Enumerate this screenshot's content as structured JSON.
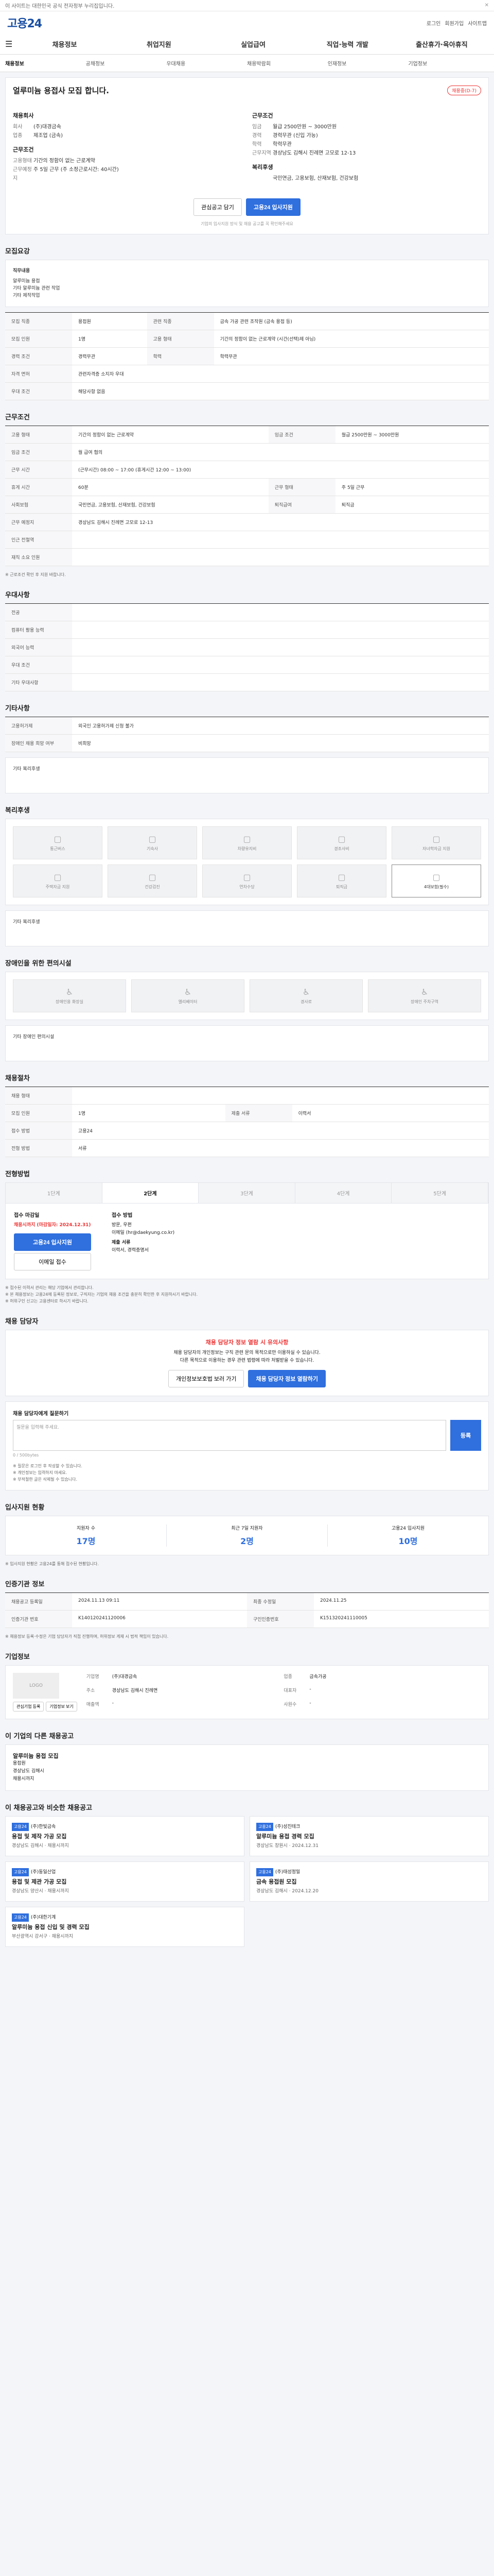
{
  "topbar": {
    "text": "이 사이트는 대한민국 공식 전자정부 누리집입니다.",
    "close": "✕"
  },
  "header": {
    "logo": "고용24",
    "links": [
      "로그인",
      "회원가입",
      "사이트맵"
    ]
  },
  "nav": {
    "items": [
      "채용정보",
      "취업지원",
      "실업급여",
      "직업·능력 개발",
      "출산휴가·육아휴직"
    ]
  },
  "subnav": {
    "items": [
      "채용정보",
      "공채정보",
      "우대채용",
      "채용박람회",
      "인재정보",
      "기업정보"
    ]
  },
  "job": {
    "title": "얼루미늄 용접사 모집 합니다.",
    "badge": "채용중(D-7)",
    "left_h1": "채용회사",
    "left_rows": [
      {
        "k": "회사",
        "v": "(주)대경금속"
      },
      {
        "k": "업종",
        "v": "제조업 (금속)"
      }
    ],
    "left_h2": "근무조건",
    "left_rows2": [
      {
        "k": "고용형태",
        "v": "기간의 정함이 없는 근로계약"
      },
      {
        "k": "근무예정지",
        "v": "주 5일 근무 (주 소정근로시간: 40시간)"
      }
    ],
    "right_h1": "근무조건",
    "right_rows": [
      {
        "k": "임금",
        "v": "월급 2500만원 ~ 3000만원"
      },
      {
        "k": "경력",
        "v": "경력무관 (신입 가능)"
      },
      {
        "k": "학력",
        "v": "학력무관"
      },
      {
        "k": "근무지역",
        "v": "경상남도 김해시 진례면 고모로 12-13"
      }
    ],
    "right_h2": "복리후생",
    "right_rows2": [
      {
        "k": "",
        "v": "국민연금, 고용보험, 산재보험, 건강보험"
      }
    ],
    "btn_interest": "관심공고 담기",
    "btn_apply": "고용24 입사지원",
    "note": "기업의 입사지원 방식 및 채용 공고를 꼭 확인해주세요"
  },
  "sec_detail": {
    "title": "모집요강",
    "box_h": "직무내용",
    "box_lines": [
      "알루미늄 용접",
      "기타 알루미늄 관련 작업",
      "기타 제작작업"
    ]
  },
  "recruit_table": [
    {
      "k": "모집 직종",
      "v": "용접원",
      "k2": "관련 직종",
      "v2": "금속 가공 관련 조작원 (금속 용접 등)"
    },
    {
      "k": "모집 인원",
      "v": "1명",
      "k2": "고용 형태",
      "v2": "기간의 정함이 없는 근로계약 (시간(선택)제 아님)"
    },
    {
      "k": "경력 조건",
      "v": "경력무관",
      "k2": "학력",
      "v2": "학력무관"
    },
    {
      "k": "자격 면허",
      "v": "관련자격증 소지자 우대",
      "k2": "",
      "v2": ""
    },
    {
      "k": "우대 조건",
      "v": "해당사항 없음",
      "k2": "",
      "v2": ""
    }
  ],
  "sec_cond": {
    "title": "근무조건"
  },
  "cond_table": [
    {
      "k": "고용 형태",
      "v": "기간의 정함이 없는 근로계약",
      "k2": "임금 조건",
      "v2": "월급 2500만원 ~ 3000만원"
    },
    {
      "k": "임금 조건",
      "v": "월 급여 협의",
      "k2": "",
      "v2": ""
    },
    {
      "k": "근무 시간",
      "v": "(근무시간) 08:00 ~ 17:00 (휴게시간 12:00 ~ 13:00)",
      "k2": "",
      "v2": ""
    },
    {
      "k": "휴게 시간",
      "v": "60분",
      "k2": "근무 형태",
      "v2": "주 5일 근무"
    },
    {
      "k": "사회보험",
      "v": "국민연금, 고용보험, 산재보험, 건강보험",
      "k2": "퇴직급여",
      "v2": "퇴직금"
    },
    {
      "k": "근무 예정지",
      "v": "경상남도 김해시 진례면 고모로 12-13",
      "k2": "",
      "v2": ""
    },
    {
      "k": "인근 전철역",
      "v": "",
      "k2": "",
      "v2": ""
    },
    {
      "k": "재직 소요 인원",
      "v": "",
      "k2": "",
      "v2": ""
    }
  ],
  "cond_note": "※ 근로조건 확인 후 지원 바랍니다.",
  "sec_pref": {
    "title": "우대사항"
  },
  "pref_table": [
    {
      "k": "전공",
      "v": ""
    },
    {
      "k": "컴퓨터 활용 능력",
      "v": ""
    },
    {
      "k": "외국어 능력",
      "v": ""
    },
    {
      "k": "우대 조건",
      "v": ""
    },
    {
      "k": "기타 우대사항",
      "v": ""
    }
  ],
  "sec_etc": {
    "title": "기타사항"
  },
  "etc_table": [
    {
      "k": "고용허가제",
      "v": "외국인 고용허가제 신청 불가"
    },
    {
      "k": "장애인 채용 희망 여부",
      "v": "비희망"
    }
  ],
  "etc_box": "기타 복리후생",
  "sec_welfare": {
    "title": "복리후생"
  },
  "welfare": [
    {
      "l": "통근버스",
      "on": false
    },
    {
      "l": "기숙사",
      "on": false
    },
    {
      "l": "차량유지비",
      "on": false
    },
    {
      "l": "경조사비",
      "on": false
    },
    {
      "l": "자녀학자금 지원",
      "on": false
    },
    {
      "l": "주택자금 지원",
      "on": false
    },
    {
      "l": "건강검진",
      "on": false
    },
    {
      "l": "연차수당",
      "on": false
    },
    {
      "l": "퇴직금",
      "on": false
    },
    {
      "l": "4대보험(필수)",
      "on": true
    }
  ],
  "welfare_box": "기타 복리후생",
  "sec_disab": {
    "title": "장애인을 위한 편의시설"
  },
  "disab": [
    {
      "l": "장애인용 화장실"
    },
    {
      "l": "엘리베이터"
    },
    {
      "l": "경사로"
    },
    {
      "l": "장애인 주차구역"
    }
  ],
  "disab_box": "기타 장애인 편의시설",
  "sec_select": {
    "title": "채용절차"
  },
  "select_table": [
    {
      "k": "채용 형태",
      "v": "",
      "k2": "",
      "v2": ""
    },
    {
      "k": "모집 인원",
      "v": "1명",
      "k2": "제출 서류",
      "v2": "이력서"
    },
    {
      "k": "접수 방법",
      "v": "고용24",
      "k2": "",
      "v2": ""
    },
    {
      "k": "전형 방법",
      "v": "서류",
      "k2": "",
      "v2": ""
    }
  ],
  "sec_apply": {
    "title": "전형방법"
  },
  "apply_tabs": [
    "1단계",
    "2단계",
    "3단계",
    "4단계",
    "5단계"
  ],
  "apply_active": 1,
  "apply_left_h": "접수 마감일",
  "apply_left_red": "채용시까지 (마감일자: 2024.12.31)",
  "apply_left_btn": "고용24 입사지원",
  "apply_left_btn2": "이메일 접수",
  "apply_right_h": "접수 방법",
  "apply_right_lines": [
    "방문, 우편",
    "이메일 (hr@daekyung.co.kr)",
    "제출 서류",
    "이력서, 경력증명서"
  ],
  "apply_notes": [
    "※ 접수된 이력서 관리는 해당 기업에서 관리합니다.",
    "※ 본 채용정보는 고용24에 등록된 정보로, 구직자는 기업의 채용 조건을 충분히 확인한 후 지원하시기 바랍니다.",
    "※ 허위구인 신고는 고용센터로 하시기 바랍니다."
  ],
  "sec_contact": {
    "title": "채용 담당자"
  },
  "contact": {
    "h": "채용 담당자 정보 열람 시 유의사항",
    "lines": [
      "채용 담당자의 개인정보는 구직 관련 문의 목적으로만 이용하실 수 있습니다.",
      "다른 목적으로 이용하는 경우 관련 법령에 따라 처벌받을 수 있습니다."
    ],
    "btn1": "개인정보보호법 보러 가기",
    "btn2": "채용 담당자 정보 열람하기"
  },
  "qa": {
    "h": "채용 담당자에게 질문하기",
    "placeholder": "질문을 입력해 주세요.",
    "btn": "등록",
    "count": "0 / 500bytes"
  },
  "qa_notes": [
    "※ 질문은 로그인 후 작성할 수 있습니다.",
    "※ 개인정보는 입력하지 마세요.",
    "※ 부적절한 글은 삭제될 수 있습니다."
  ],
  "sec_stats": {
    "title": "입사지원 현황"
  },
  "stats": [
    {
      "l": "지원자 수",
      "n": "17명"
    },
    {
      "l": "최근 7일 지원자",
      "n": "2명"
    },
    {
      "l": "고용24 입사지원",
      "n": "10명"
    }
  ],
  "stats_note": "※ 입사지원 현황은 고용24를 통해 접수된 현황입니다.",
  "sec_info": {
    "title": "인증기관 정보"
  },
  "info_table": [
    {
      "k": "채용공고 등록일",
      "v": "2024.11.13 09:11",
      "k2": "최종 수정일",
      "v2": "2024.11.25"
    },
    {
      "k": "인증기관 번호",
      "v": "K140120241120006",
      "k2": "구인인증번호",
      "v2": "K151320241110005"
    }
  ],
  "info_note": "※ 채용정보 등록·수정은 기업 담당자가 직접 진행하며, 허위정보 게재 시 법적 책임이 있습니다.",
  "sec_company": {
    "title": "기업정보"
  },
  "company": {
    "logo": "LOGO",
    "rows": [
      {
        "k": "기업명",
        "v": "(주)대경금속",
        "k2": "업종",
        "v2": "금속가공"
      },
      {
        "k": "주소",
        "v": "경상남도 김해시 진례면",
        "k2": "대표자",
        "v2": "-"
      },
      {
        "k": "매출액",
        "v": "-",
        "k2": "사원수",
        "v2": "-"
      }
    ],
    "btn1": "관심기업 등록",
    "btn2": "기업정보 보기"
  },
  "sec_other": {
    "title": "이 기업의 다른 채용공고"
  },
  "other": {
    "h": "알루미늄 용접 모집",
    "lines": [
      "용접원",
      "경상남도 김해시",
      "채용시까지"
    ]
  },
  "sec_rec": {
    "title": "이 채용공고와 비슷한 채용공고"
  },
  "rec": [
    {
      "tag": "고용24",
      "company": "(주)한빛금속",
      "title": "용접 및 제작 가공 모집",
      "meta": "경상남도 김해시 · 채용시까지"
    },
    {
      "tag": "고용24",
      "company": "(주)성진테크",
      "title": "알루미늄 용접 경력 모집",
      "meta": "경상남도 창원시 · 2024.12.31"
    },
    {
      "tag": "고용24",
      "company": "(주)동일산업",
      "title": "용접 및 제관 가공 모집",
      "meta": "경상남도 양산시 · 채용시까지"
    },
    {
      "tag": "고용24",
      "company": "(주)태성정밀",
      "title": "금속 용접원 모집",
      "meta": "경상남도 김해시 · 2024.12.20"
    },
    {
      "tag": "고용24",
      "company": "(주)대한기계",
      "title": "알루미늄 용접 신입 및 경력 모집",
      "meta": "부산광역시 강서구 · 채용시까지"
    }
  ]
}
